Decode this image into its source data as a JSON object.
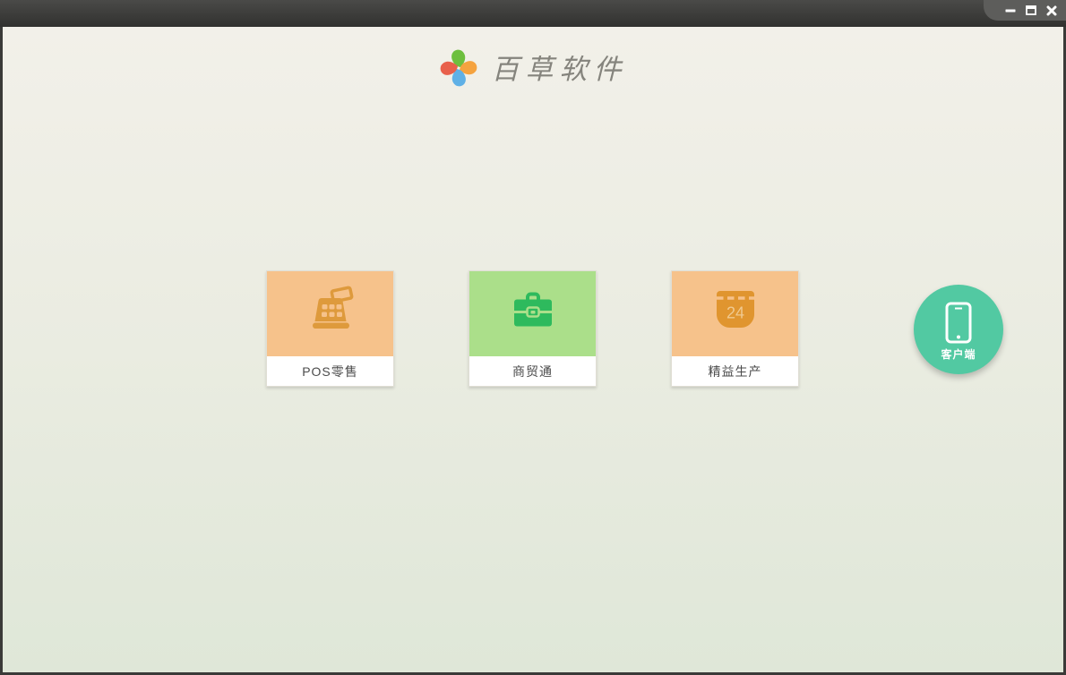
{
  "window": {
    "controls": [
      {
        "name": "minimize",
        "icon": "minimize-icon"
      },
      {
        "name": "maximize",
        "icon": "maximize-icon"
      },
      {
        "name": "close",
        "icon": "close-icon"
      }
    ]
  },
  "header": {
    "app_title": "百草软件",
    "logo_icon": "pinwheel-icon",
    "logo_petal_colors": {
      "top": "#6dbf3e",
      "right": "#f5a33f",
      "bottom": "#5fb0e6",
      "left": "#e8604b"
    }
  },
  "products": [
    {
      "label": "POS零售",
      "icon": "cash-register-icon",
      "tile_bg": "#f6c28b",
      "icon_color": "#de9a3c"
    },
    {
      "label": "商贸通",
      "icon": "briefcase-icon",
      "tile_bg": "#abdf8a",
      "icon_color": "#2eba5d"
    },
    {
      "label": "精益生产",
      "icon": "calendar-icon",
      "tile_bg": "#f6c28b",
      "icon_color": "#e0952f",
      "calendar_day": "24"
    }
  ],
  "client_button": {
    "label": "客户端",
    "icon": "smartphone-icon",
    "bg_color": "#52c9a2"
  },
  "theme": {
    "titlebar_top": "#4a4a48",
    "titlebar_bottom": "#31312f",
    "content_bg_top": "#f2f0e9",
    "content_bg_bottom": "#dfe7d8"
  }
}
